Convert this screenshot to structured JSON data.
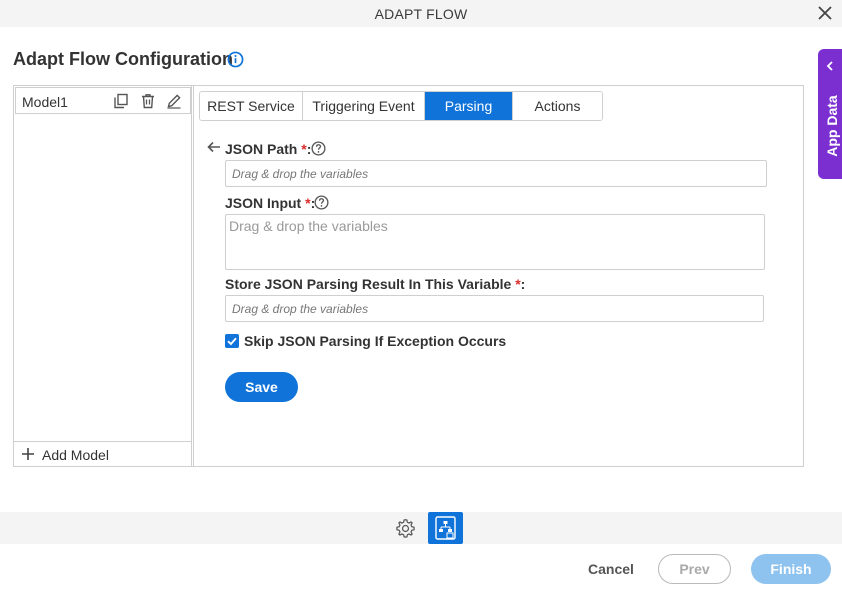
{
  "window": {
    "title": "ADAPT FLOW"
  },
  "page": {
    "title": "Adapt Flow Configuration"
  },
  "side_panel": {
    "label": "App Data"
  },
  "models": {
    "items": [
      {
        "name": "Model1"
      }
    ],
    "add_label": "Add Model"
  },
  "tabs": [
    {
      "label": "REST Service",
      "active": false
    },
    {
      "label": "Triggering Event",
      "active": false
    },
    {
      "label": "Parsing",
      "active": true
    },
    {
      "label": "Actions",
      "active": false
    }
  ],
  "form": {
    "json_path": {
      "label": "JSON Path",
      "required_mark": "*",
      "suffix": ":",
      "placeholder": "Drag & drop the variables"
    },
    "json_input": {
      "label": "JSON Input",
      "required_mark": "*",
      "suffix": ":",
      "placeholder": "Drag & drop the variables"
    },
    "store_result": {
      "label": "Store JSON Parsing Result In This Variable",
      "required_mark": "*",
      "suffix": ":",
      "placeholder": "Drag & drop the variables"
    },
    "skip_exception": {
      "label": "Skip JSON Parsing If Exception Occurs",
      "checked": true
    },
    "save_label": "Save"
  },
  "footer": {
    "cancel_label": "Cancel",
    "prev_label": "Prev",
    "finish_label": "Finish"
  },
  "colors": {
    "primary": "#0f73d9",
    "side_panel": "#7b2fd1",
    "required": "#d92b2b",
    "finish_disabled": "#8ec3ef"
  },
  "icons": {
    "close": "close-icon",
    "info": "info-icon",
    "copy": "copy-icon",
    "delete": "trash-icon",
    "edit": "pencil-icon",
    "add": "plus-icon",
    "back": "arrow-left-icon",
    "help": "help-icon",
    "settings": "gear-icon",
    "flow": "flow-designer-icon"
  }
}
